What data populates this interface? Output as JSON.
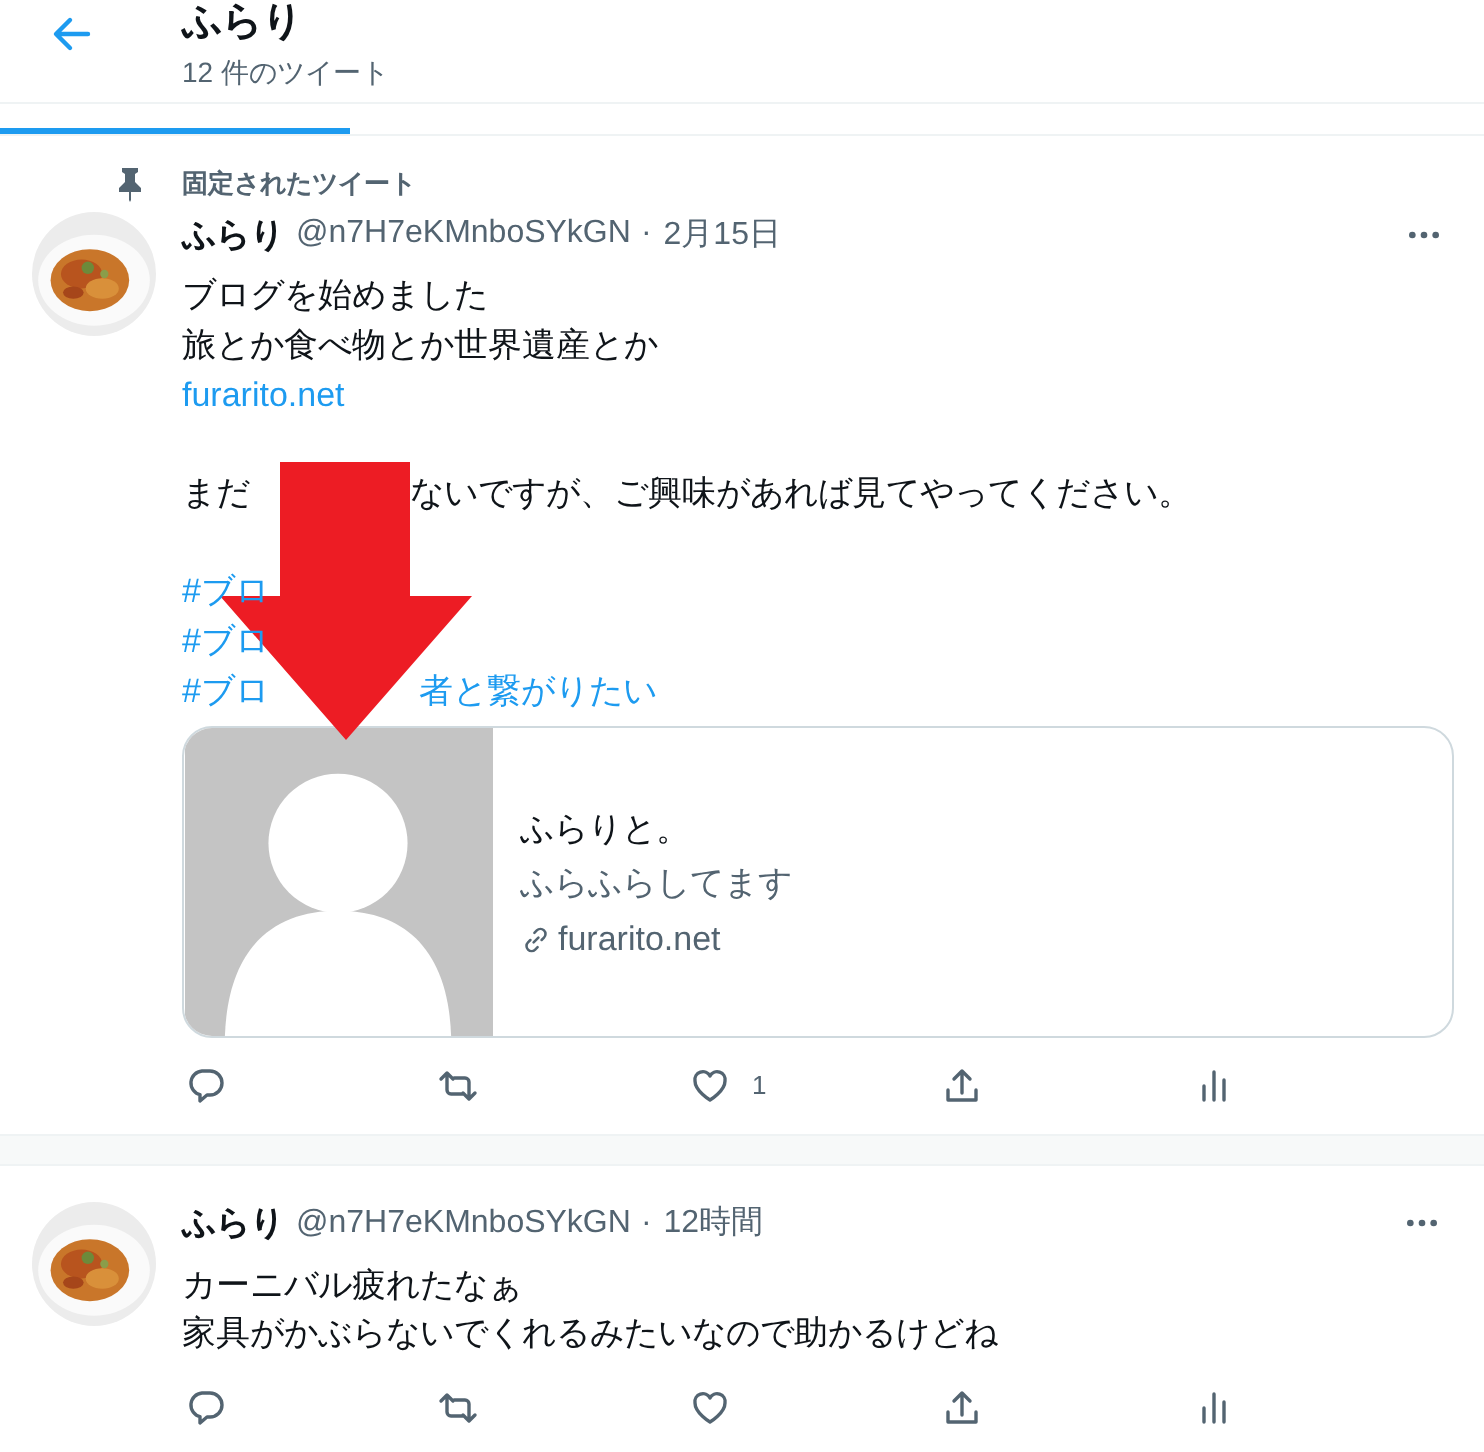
{
  "header": {
    "title": "ふらり",
    "subtitle": "12 件のツイート"
  },
  "tweets": [
    {
      "pinned": true,
      "pinned_label": "固定されたツイート",
      "name": "ふらり",
      "handle": "@n7H7eKMnboSYkGN",
      "separator": "·",
      "time": "2月15日",
      "lines": [
        {
          "kind": "text",
          "segments": [
            "ブログを始めました"
          ]
        },
        {
          "kind": "text",
          "segments": [
            "旅とか食べ物とか世界遺産とか"
          ]
        },
        {
          "kind": "link",
          "segments": [
            "furarito.net"
          ]
        },
        {
          "kind": "blank"
        },
        {
          "kind": "text",
          "segments": [
            "まだ",
            "ないですが、ご興味があれば見てやってください。"
          ]
        },
        {
          "kind": "blank"
        },
        {
          "kind": "hashtag",
          "segments": [
            "#ブロ"
          ]
        },
        {
          "kind": "hashtag",
          "segments": [
            "#ブロ"
          ]
        },
        {
          "kind": "hashtag",
          "segments": [
            "#ブロ",
            "者と繋がりたい"
          ]
        }
      ],
      "card": {
        "title": "ふらりと。",
        "description": "ふらふらしてます",
        "domain": "furarito.net"
      },
      "actions": [
        {
          "kind": "reply"
        },
        {
          "kind": "retweet"
        },
        {
          "kind": "like",
          "count": "1"
        },
        {
          "kind": "share"
        },
        {
          "kind": "stats"
        }
      ]
    },
    {
      "pinned": false,
      "name": "ふらり",
      "handle": "@n7H7eKMnboSYkGN",
      "separator": "·",
      "time": "12時間",
      "lines": [
        {
          "kind": "text",
          "segments": [
            "カーニバル疲れたなぁ"
          ]
        },
        {
          "kind": "text",
          "segments": [
            "家具がかぶらないでくれるみたいなので助かるけどね"
          ]
        }
      ],
      "actions": [
        {
          "kind": "reply"
        },
        {
          "kind": "retweet"
        },
        {
          "kind": "like"
        },
        {
          "kind": "share"
        },
        {
          "kind": "stats"
        }
      ]
    }
  ]
}
